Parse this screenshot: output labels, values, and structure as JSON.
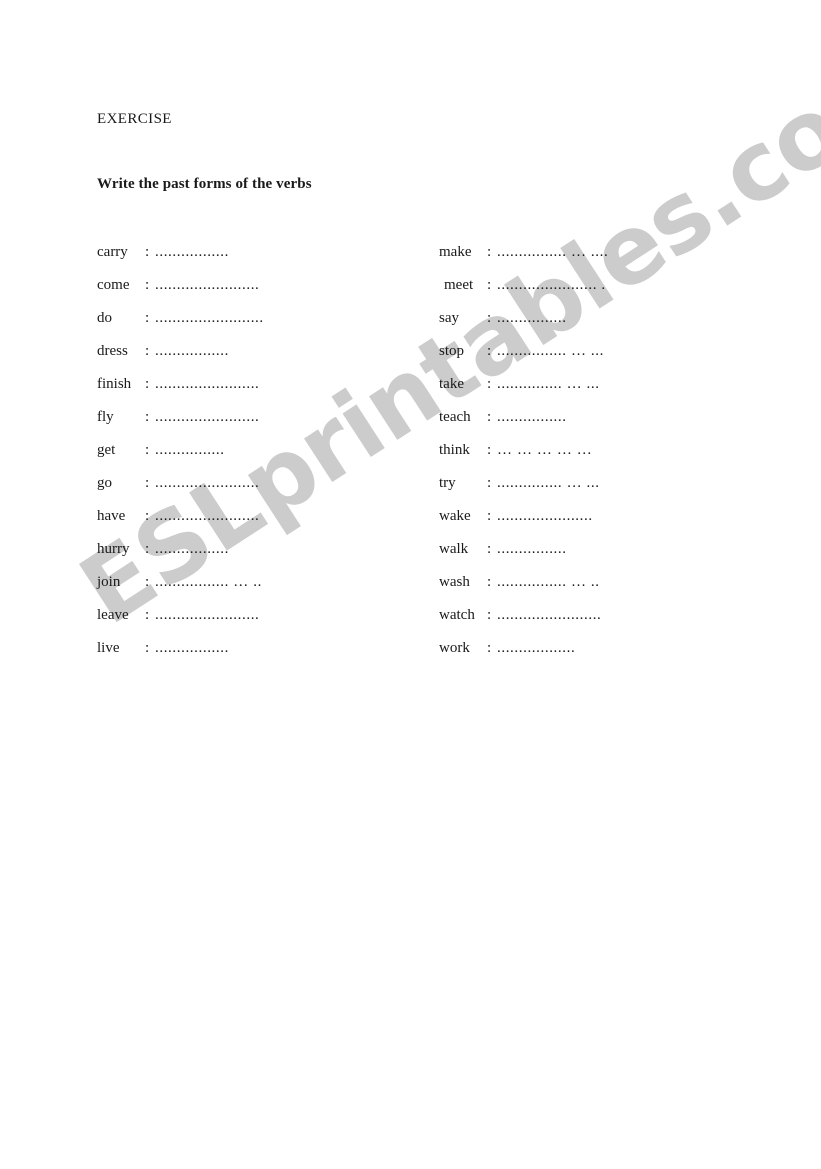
{
  "document": {
    "title": "EXERCISE",
    "instruction": "Write the past forms of the verbs"
  },
  "watermark": {
    "text": "ESLprintables.com",
    "color": "#cccccc",
    "rotation_deg": -33
  },
  "colors": {
    "page_background": "#ffffff",
    "text": "#1a1a1a",
    "watermark": "#cccccc"
  },
  "separator": ":",
  "columns": {
    "left": [
      {
        "verb": "carry",
        "answer_line": "................."
      },
      {
        "verb": "come",
        "answer_line": "........................"
      },
      {
        "verb": "do",
        "answer_line": "........................."
      },
      {
        "verb": "dress",
        "answer_line": "................."
      },
      {
        "verb": "finish",
        "answer_line": "........................"
      },
      {
        "verb": "fly",
        "answer_line": "........................"
      },
      {
        "verb": "get",
        "answer_line": "................"
      },
      {
        "verb": "go",
        "answer_line": "........................"
      },
      {
        "verb": "have",
        "answer_line": "........................"
      },
      {
        "verb": "hurry",
        "answer_line": "................."
      },
      {
        "verb": "join",
        "answer_line": "................. … .."
      },
      {
        "verb": "leave",
        "answer_line": "........................"
      },
      {
        "verb": "live",
        "answer_line": "................."
      }
    ],
    "right": [
      {
        "verb": "make",
        "answer_line": "................ … ....",
        "indent": false
      },
      {
        "verb": "meet",
        "answer_line": "....................... .",
        "indent": true
      },
      {
        "verb": "say",
        "answer_line": "................",
        "indent": false
      },
      {
        "verb": "stop",
        "answer_line": "................ … ...",
        "indent": false
      },
      {
        "verb": "take",
        "answer_line": "............... … ...",
        "indent": false
      },
      {
        "verb": "teach",
        "answer_line": "................",
        "indent": false
      },
      {
        "verb": "think",
        "answer_line": "… … … … …",
        "indent": false
      },
      {
        "verb": "try",
        "answer_line": "............... … ...",
        "indent": false
      },
      {
        "verb": "wake",
        "answer_line": "......................",
        "indent": false
      },
      {
        "verb": "walk",
        "answer_line": "................",
        "indent": false
      },
      {
        "verb": "wash",
        "answer_line": "................ … ..",
        "indent": false
      },
      {
        "verb": "watch",
        "answer_line": "........................",
        "indent": false
      },
      {
        "verb": "work",
        "answer_line": ".................."
      }
    ]
  }
}
